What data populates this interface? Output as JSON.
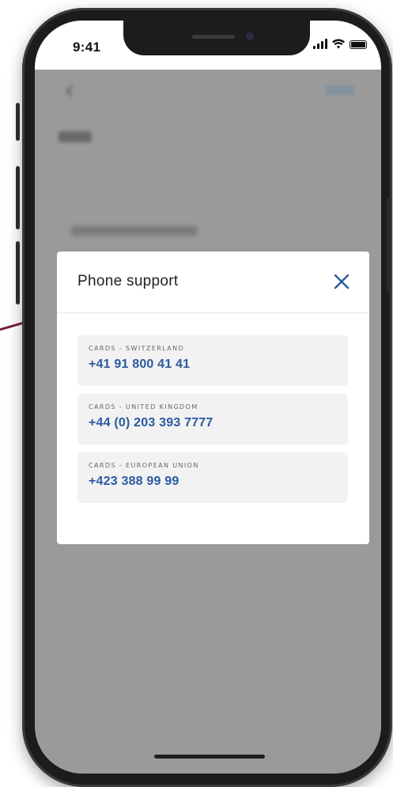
{
  "status_bar": {
    "time": "9:41"
  },
  "modal": {
    "title": "Phone support",
    "close_icon": "close-icon",
    "contacts": [
      {
        "label": "CARDS - SWITZERLAND",
        "phone": "+41 91 800 41 41"
      },
      {
        "label": "CARDS - UNITED KINGDOM",
        "phone": "+44 (0) 203 393 7777"
      },
      {
        "label": "CARDS - EUROPEAN UNION",
        "phone": "+423 388 99 99"
      }
    ]
  },
  "colors": {
    "accent": "#2a5aa0",
    "overlay": "#9a9a9a",
    "brand_line": "#7a1f3d"
  }
}
